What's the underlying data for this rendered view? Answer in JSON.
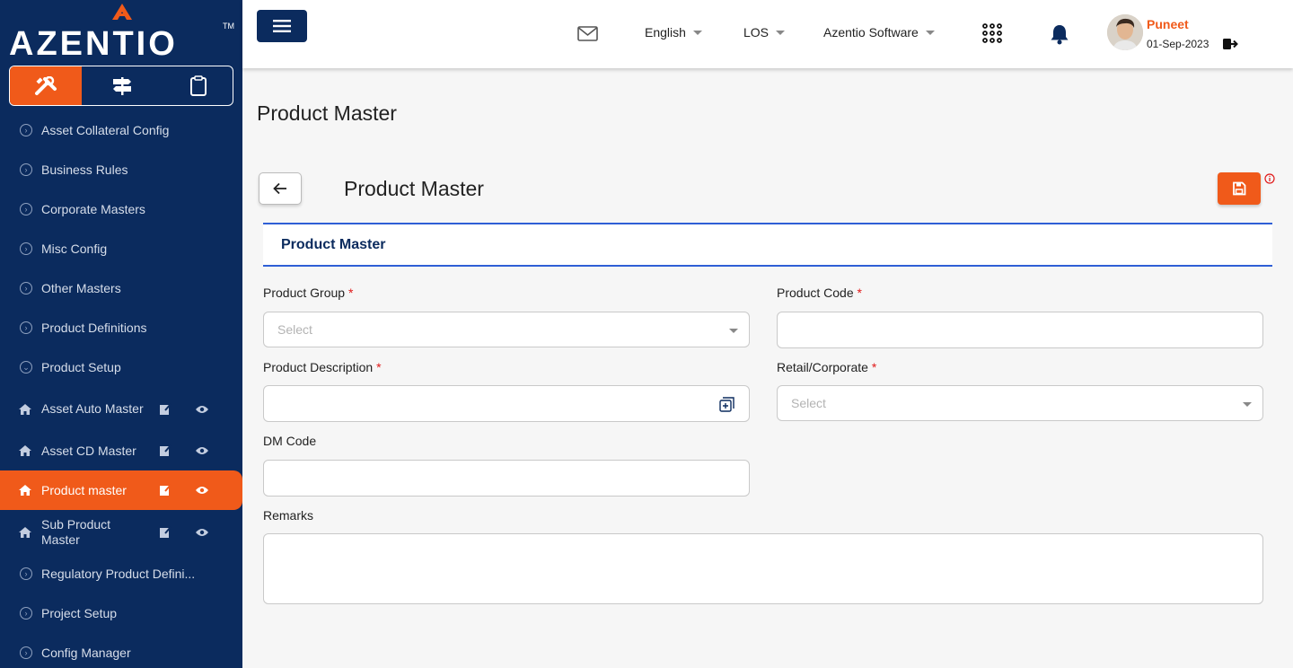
{
  "brand": {
    "name": "AZENTIO",
    "tm": "TM",
    "accent": "#f05a1a",
    "navy": "#0b2b5e"
  },
  "sidebar": {
    "mode_tabs": [
      {
        "icon": "tools-icon"
      },
      {
        "icon": "signpost-icon"
      },
      {
        "icon": "clipboard-icon"
      }
    ],
    "items": [
      {
        "label": "Asset Collateral Config"
      },
      {
        "label": "Business Rules"
      },
      {
        "label": "Corporate Masters"
      },
      {
        "label": "Misc Config"
      },
      {
        "label": "Other Masters"
      },
      {
        "label": "Product Definitions"
      },
      {
        "label": "Product Setup"
      },
      {
        "label": "Asset Auto Master"
      },
      {
        "label": "Asset CD Master"
      },
      {
        "label": "Product master"
      },
      {
        "label": "Sub Product Master"
      },
      {
        "label": "Regulatory Product Defini..."
      },
      {
        "label": "Project Setup"
      },
      {
        "label": "Config Manager"
      }
    ]
  },
  "header": {
    "language": "English",
    "module": "LOS",
    "company": "Azentio Software",
    "user": {
      "name": "Puneet",
      "date": "01-Sep-2023"
    }
  },
  "page": {
    "title": "Product Master"
  },
  "form": {
    "card_title": "Product Master",
    "section_title": "Product Master",
    "required_mark": "*",
    "fields": {
      "product_group": {
        "label": "Product Group",
        "placeholder": "Select"
      },
      "product_code": {
        "label": "Product Code",
        "value": ""
      },
      "product_description": {
        "label": "Product Description",
        "value": ""
      },
      "retail_corporate": {
        "label": "Retail/Corporate",
        "placeholder": "Select"
      },
      "dm_code": {
        "label": "DM Code",
        "value": ""
      },
      "remarks": {
        "label": "Remarks",
        "value": ""
      }
    }
  }
}
